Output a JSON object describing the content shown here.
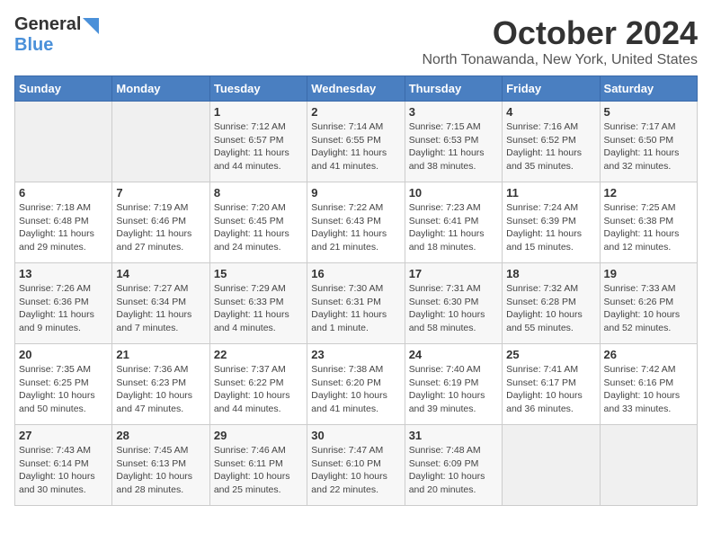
{
  "header": {
    "logo_general": "General",
    "logo_blue": "Blue",
    "month_title": "October 2024",
    "location": "North Tonawanda, New York, United States"
  },
  "days_of_week": [
    "Sunday",
    "Monday",
    "Tuesday",
    "Wednesday",
    "Thursday",
    "Friday",
    "Saturday"
  ],
  "weeks": [
    [
      {
        "day": "",
        "info": ""
      },
      {
        "day": "",
        "info": ""
      },
      {
        "day": "1",
        "sunrise": "7:12 AM",
        "sunset": "6:57 PM",
        "daylight": "11 hours and 44 minutes."
      },
      {
        "day": "2",
        "sunrise": "7:14 AM",
        "sunset": "6:55 PM",
        "daylight": "11 hours and 41 minutes."
      },
      {
        "day": "3",
        "sunrise": "7:15 AM",
        "sunset": "6:53 PM",
        "daylight": "11 hours and 38 minutes."
      },
      {
        "day": "4",
        "sunrise": "7:16 AM",
        "sunset": "6:52 PM",
        "daylight": "11 hours and 35 minutes."
      },
      {
        "day": "5",
        "sunrise": "7:17 AM",
        "sunset": "6:50 PM",
        "daylight": "11 hours and 32 minutes."
      }
    ],
    [
      {
        "day": "6",
        "sunrise": "7:18 AM",
        "sunset": "6:48 PM",
        "daylight": "11 hours and 29 minutes."
      },
      {
        "day": "7",
        "sunrise": "7:19 AM",
        "sunset": "6:46 PM",
        "daylight": "11 hours and 27 minutes."
      },
      {
        "day": "8",
        "sunrise": "7:20 AM",
        "sunset": "6:45 PM",
        "daylight": "11 hours and 24 minutes."
      },
      {
        "day": "9",
        "sunrise": "7:22 AM",
        "sunset": "6:43 PM",
        "daylight": "11 hours and 21 minutes."
      },
      {
        "day": "10",
        "sunrise": "7:23 AM",
        "sunset": "6:41 PM",
        "daylight": "11 hours and 18 minutes."
      },
      {
        "day": "11",
        "sunrise": "7:24 AM",
        "sunset": "6:39 PM",
        "daylight": "11 hours and 15 minutes."
      },
      {
        "day": "12",
        "sunrise": "7:25 AM",
        "sunset": "6:38 PM",
        "daylight": "11 hours and 12 minutes."
      }
    ],
    [
      {
        "day": "13",
        "sunrise": "7:26 AM",
        "sunset": "6:36 PM",
        "daylight": "11 hours and 9 minutes."
      },
      {
        "day": "14",
        "sunrise": "7:27 AM",
        "sunset": "6:34 PM",
        "daylight": "11 hours and 7 minutes."
      },
      {
        "day": "15",
        "sunrise": "7:29 AM",
        "sunset": "6:33 PM",
        "daylight": "11 hours and 4 minutes."
      },
      {
        "day": "16",
        "sunrise": "7:30 AM",
        "sunset": "6:31 PM",
        "daylight": "11 hours and 1 minute."
      },
      {
        "day": "17",
        "sunrise": "7:31 AM",
        "sunset": "6:30 PM",
        "daylight": "10 hours and 58 minutes."
      },
      {
        "day": "18",
        "sunrise": "7:32 AM",
        "sunset": "6:28 PM",
        "daylight": "10 hours and 55 minutes."
      },
      {
        "day": "19",
        "sunrise": "7:33 AM",
        "sunset": "6:26 PM",
        "daylight": "10 hours and 52 minutes."
      }
    ],
    [
      {
        "day": "20",
        "sunrise": "7:35 AM",
        "sunset": "6:25 PM",
        "daylight": "10 hours and 50 minutes."
      },
      {
        "day": "21",
        "sunrise": "7:36 AM",
        "sunset": "6:23 PM",
        "daylight": "10 hours and 47 minutes."
      },
      {
        "day": "22",
        "sunrise": "7:37 AM",
        "sunset": "6:22 PM",
        "daylight": "10 hours and 44 minutes."
      },
      {
        "day": "23",
        "sunrise": "7:38 AM",
        "sunset": "6:20 PM",
        "daylight": "10 hours and 41 minutes."
      },
      {
        "day": "24",
        "sunrise": "7:40 AM",
        "sunset": "6:19 PM",
        "daylight": "10 hours and 39 minutes."
      },
      {
        "day": "25",
        "sunrise": "7:41 AM",
        "sunset": "6:17 PM",
        "daylight": "10 hours and 36 minutes."
      },
      {
        "day": "26",
        "sunrise": "7:42 AM",
        "sunset": "6:16 PM",
        "daylight": "10 hours and 33 minutes."
      }
    ],
    [
      {
        "day": "27",
        "sunrise": "7:43 AM",
        "sunset": "6:14 PM",
        "daylight": "10 hours and 30 minutes."
      },
      {
        "day": "28",
        "sunrise": "7:45 AM",
        "sunset": "6:13 PM",
        "daylight": "10 hours and 28 minutes."
      },
      {
        "day": "29",
        "sunrise": "7:46 AM",
        "sunset": "6:11 PM",
        "daylight": "10 hours and 25 minutes."
      },
      {
        "day": "30",
        "sunrise": "7:47 AM",
        "sunset": "6:10 PM",
        "daylight": "10 hours and 22 minutes."
      },
      {
        "day": "31",
        "sunrise": "7:48 AM",
        "sunset": "6:09 PM",
        "daylight": "10 hours and 20 minutes."
      },
      {
        "day": "",
        "info": ""
      },
      {
        "day": "",
        "info": ""
      }
    ]
  ],
  "labels": {
    "sunrise": "Sunrise:",
    "sunset": "Sunset:",
    "daylight": "Daylight:"
  }
}
